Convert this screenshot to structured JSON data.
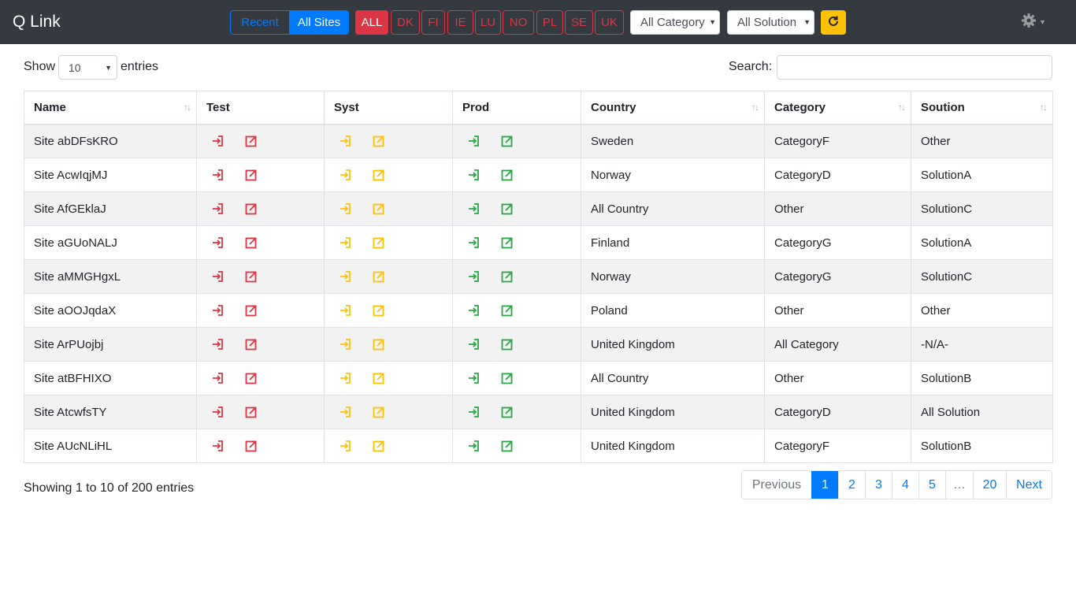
{
  "app": {
    "title": "Q Link"
  },
  "navbar": {
    "recent_label": "Recent",
    "all_sites_label": "All Sites",
    "countries": [
      "ALL",
      "DK",
      "FI",
      "IE",
      "LU",
      "NO",
      "PL",
      "SE",
      "UK"
    ],
    "category_select": "All Category",
    "solution_select": "All Solution"
  },
  "controls": {
    "show_label": "Show",
    "entries_value": "10",
    "entries_label": "entries",
    "search_label": "Search:"
  },
  "table": {
    "headers": [
      "Name",
      "Test",
      "Syst",
      "Prod",
      "Country",
      "Category",
      "Soution"
    ],
    "rows": [
      {
        "name": "Site abDFsKRO",
        "country": "Sweden",
        "category": "CategoryF",
        "solution": "Other"
      },
      {
        "name": "Site AcwIqjMJ",
        "country": "Norway",
        "category": "CategoryD",
        "solution": "SolutionA"
      },
      {
        "name": "Site AfGEklaJ",
        "country": "All Country",
        "category": "Other",
        "solution": "SolutionC"
      },
      {
        "name": "Site aGUoNALJ",
        "country": "Finland",
        "category": "CategoryG",
        "solution": "SolutionA"
      },
      {
        "name": "Site aMMGHgxL",
        "country": "Norway",
        "category": "CategoryG",
        "solution": "SolutionC"
      },
      {
        "name": "Site aOOJqdaX",
        "country": "Poland",
        "category": "Other",
        "solution": "Other"
      },
      {
        "name": "Site ArPUojbj",
        "country": "United Kingdom",
        "category": "All Category",
        "solution": "-N/A-"
      },
      {
        "name": "Site atBFHIXO",
        "country": "All Country",
        "category": "Other",
        "solution": "SolutionB"
      },
      {
        "name": "Site AtcwfsTY",
        "country": "United Kingdom",
        "category": "CategoryD",
        "solution": "All Solution"
      },
      {
        "name": "Site AUcNLiHL",
        "country": "United Kingdom",
        "category": "CategoryF",
        "solution": "SolutionB"
      }
    ]
  },
  "footer": {
    "info": "Showing 1 to 10 of 200 entries",
    "pages": [
      "Previous",
      "1",
      "2",
      "3",
      "4",
      "5",
      "…",
      "20",
      "Next"
    ]
  },
  "colors": {
    "navbar": "#343a40",
    "primary": "#007bff",
    "danger": "#dc3545",
    "warning": "#ffc107",
    "success": "#28a745"
  },
  "icons": {
    "env_login": "sign-in-icon",
    "env_external": "external-link-icon",
    "refresh": "refresh-icon",
    "settings": "gear-icon"
  }
}
